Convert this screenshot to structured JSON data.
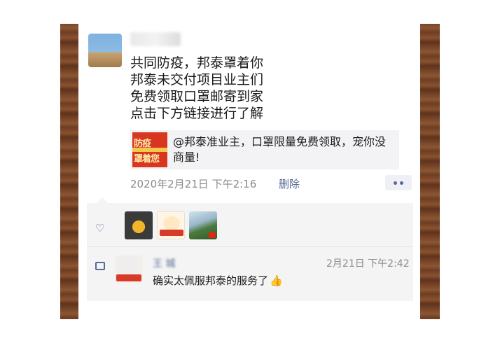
{
  "post": {
    "lines": [
      "共同防疫，邦泰罩着你",
      "邦泰未交付项目业主们",
      "免费领取口罩邮寄到家",
      "点击下方链接进行了解"
    ],
    "link": {
      "thumb_text_top": "防疫",
      "thumb_text_bottom": "罩着您",
      "text": "@邦泰准业主，口罩限量免费领取，宠你没商量!"
    },
    "timestamp": "2020年2月21日 下午2:16",
    "delete_label": "删除"
  },
  "likes": {
    "icon": "heart-icon",
    "avatars": [
      "maple-leaf-avatar",
      "cartoon-china-banner-avatar",
      "landscape-flag-avatar"
    ]
  },
  "comment": {
    "icon": "comment-bubble-icon",
    "author": "王 城",
    "time": "2月21日 下午2:42",
    "text": "确实太佩服邦泰的服务了"
  },
  "colors": {
    "link_blue": "#576b95",
    "card_bg": "#f3f3f5",
    "wood": "#7a4628"
  }
}
